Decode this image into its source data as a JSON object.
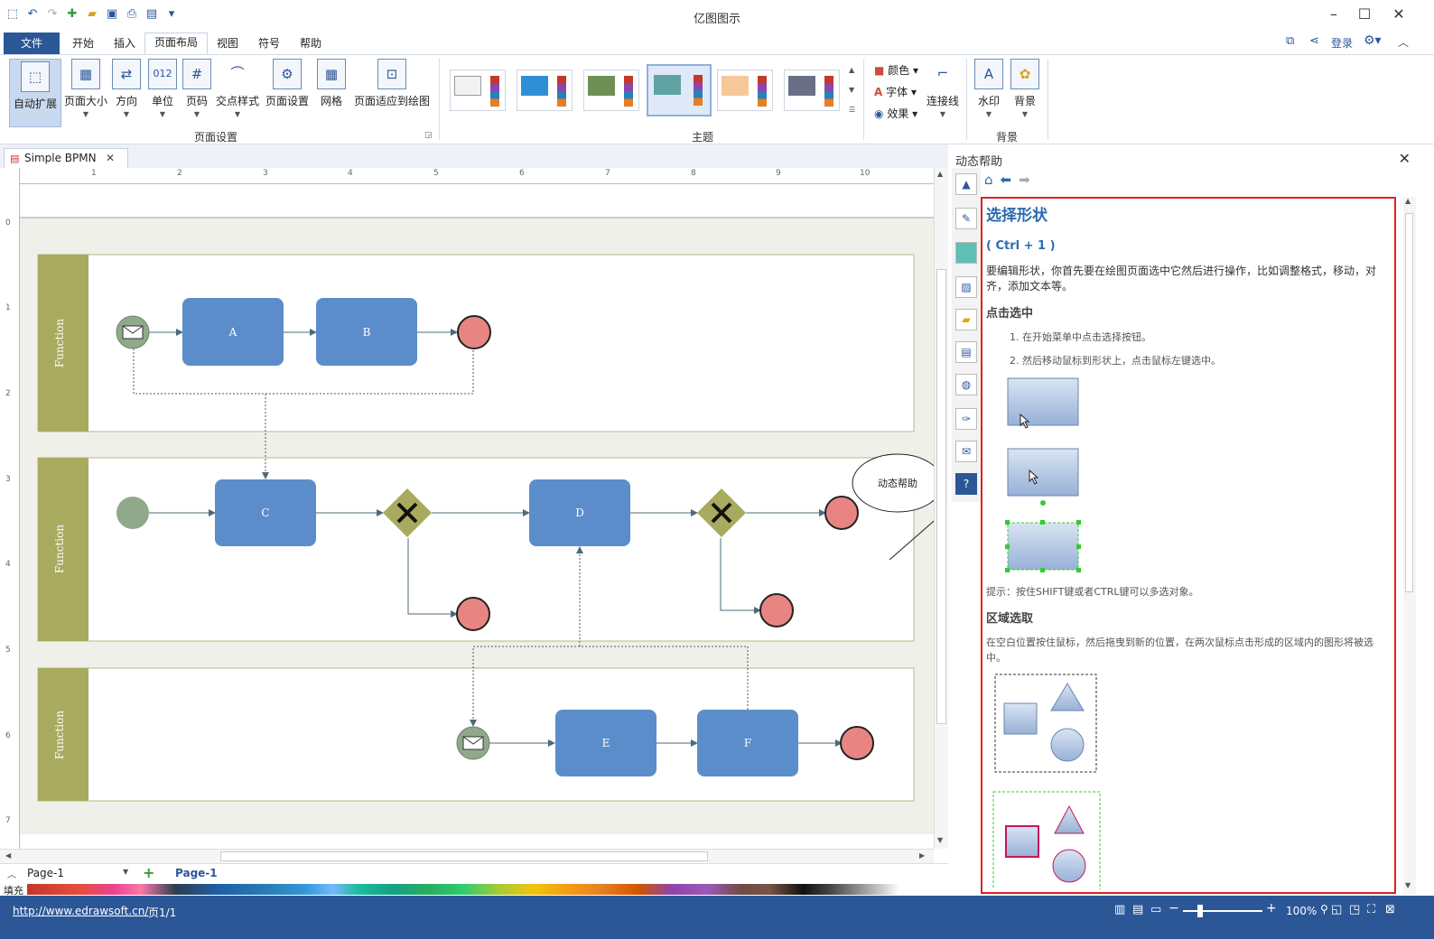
{
  "app": {
    "title": "亿图图示"
  },
  "menu": [
    "文件",
    "开始",
    "插入",
    "页面布局",
    "视图",
    "符号",
    "帮助"
  ],
  "menu_active": "页面布局",
  "account": {
    "login": "登录"
  },
  "ribbon": {
    "page_setup": {
      "label": "页面设置",
      "buttons": [
        "自动扩展",
        "页面大小",
        "方向",
        "单位",
        "页码",
        "交点样式",
        "页面设置",
        "网格",
        "页面适应到绘图"
      ]
    },
    "theme": {
      "label": "主题"
    },
    "options": {
      "color": "颜色",
      "font": "字体",
      "effect": "效果",
      "connector": "连接线"
    },
    "background": {
      "label": "背景",
      "buttons": [
        "水印",
        "背景"
      ]
    }
  },
  "document": {
    "tab": "Simple BPMN"
  },
  "ruler": {
    "h": [
      "1",
      "2",
      "3",
      "4",
      "5",
      "6",
      "7",
      "8",
      "9",
      "10"
    ],
    "v": [
      "0",
      "1",
      "2",
      "3",
      "4",
      "5",
      "6",
      "7"
    ]
  },
  "diagram": {
    "lanes": [
      "Function",
      "Function",
      "Function"
    ],
    "tasks": {
      "A": "A",
      "B": "B",
      "C": "C",
      "D": "D",
      "E": "E",
      "F": "F"
    },
    "callout": "动态帮助",
    "colors": {
      "lane": "#a8ab5f",
      "task": "#5b8dcb",
      "start": "#8fa98a",
      "end": "#e88582",
      "gateway": "#a8ab5f"
    }
  },
  "pages": {
    "current": "Page-1",
    "tab": "Page-1"
  },
  "palette": {
    "label": "填充"
  },
  "status": {
    "url": "http://www.edrawsoft.cn/",
    "page": "页1/1",
    "zoom": "100%"
  },
  "help": {
    "title": "动态帮助",
    "heading": "选择形状",
    "shortcut": "( Ctrl + 1 )",
    "intro": "要编辑形状，你首先要在绘图页面选中它然后进行操作，比如调整格式，移动，对齐，添加文本等。",
    "click_select": "点击选中",
    "steps": [
      "在开始菜单中点击选择按钮。",
      "然后移动鼠标到形状上，点击鼠标左键选中。"
    ],
    "tip": "提示：按住SHIFT键或者CTRL键可以多选对象。",
    "area_select": "区域选取",
    "area_desc": "在空白位置按住鼠标，然后拖曳到新的位置，在两次鼠标点击形成的区域内的图形将被选中。"
  }
}
